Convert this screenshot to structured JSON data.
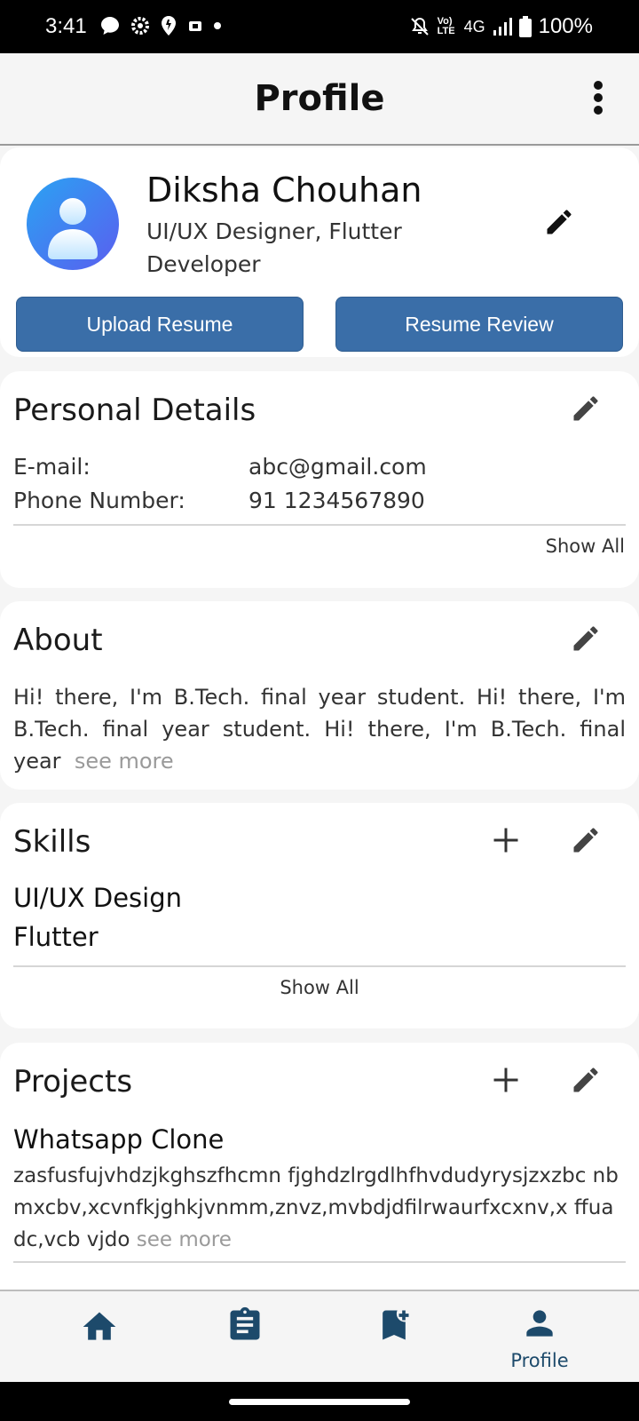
{
  "status": {
    "time": "3:41",
    "network": "4G",
    "battery": "100%",
    "lte_badge": "Vo) LTE"
  },
  "app_bar": {
    "title": "Profile"
  },
  "profile": {
    "name": "Diksha Chouhan",
    "role_line1": "UI/UX Designer, Flutter",
    "role_line2": "Developer",
    "upload_label": "Upload Resume",
    "review_label": "Resume Review"
  },
  "personal": {
    "title": "Personal Details",
    "email_label": "E-mail:",
    "email_value": "abc@gmail.com",
    "phone_label": "Phone Number:",
    "phone_value": "91 1234567890",
    "show_all": "Show All"
  },
  "about": {
    "title": "About",
    "text": "Hi! there, I'm B.Tech. final year student. Hi! there, I'm B.Tech. final year student. Hi! there, I'm B.Tech. final year",
    "see_more": "see more"
  },
  "skills": {
    "title": "Skills",
    "items": [
      "UI/UX Design",
      "Flutter"
    ],
    "show_all": "Show All"
  },
  "projects": {
    "title": "Projects",
    "name": "Whatsapp Clone",
    "desc": "zasfusfujvhdzjkghszfhcmn  fjghdzlrgdlhfhvdudyrysjzxzbc nbmxcbv,xcvnfkjghkjvnmm,znvz,mvbdjdfilrwaurfxcxnv,x ffuadc,vcb vjdo",
    "see_more": "see more"
  },
  "nav": {
    "profile_label": "Profile"
  },
  "colors": {
    "accent": "#3a6ea8",
    "nav_icon": "#1d4a6b"
  }
}
